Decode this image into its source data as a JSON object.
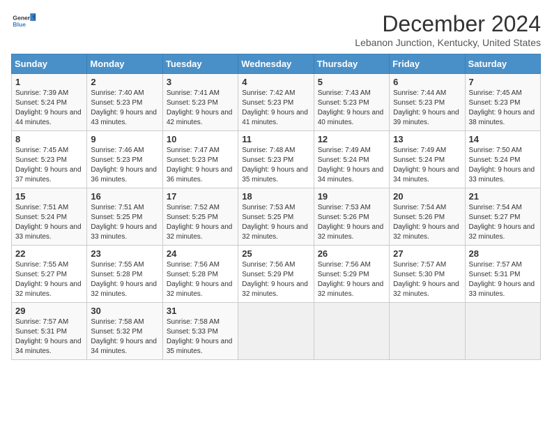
{
  "logo": {
    "general": "General",
    "blue": "Blue"
  },
  "title": "December 2024",
  "location": "Lebanon Junction, Kentucky, United States",
  "days_of_week": [
    "Sunday",
    "Monday",
    "Tuesday",
    "Wednesday",
    "Thursday",
    "Friday",
    "Saturday"
  ],
  "weeks": [
    [
      {
        "day": 1,
        "sunrise": "7:39 AM",
        "sunset": "5:24 PM",
        "daylight": "9 hours and 44 minutes."
      },
      {
        "day": 2,
        "sunrise": "7:40 AM",
        "sunset": "5:23 PM",
        "daylight": "9 hours and 43 minutes."
      },
      {
        "day": 3,
        "sunrise": "7:41 AM",
        "sunset": "5:23 PM",
        "daylight": "9 hours and 42 minutes."
      },
      {
        "day": 4,
        "sunrise": "7:42 AM",
        "sunset": "5:23 PM",
        "daylight": "9 hours and 41 minutes."
      },
      {
        "day": 5,
        "sunrise": "7:43 AM",
        "sunset": "5:23 PM",
        "daylight": "9 hours and 40 minutes."
      },
      {
        "day": 6,
        "sunrise": "7:44 AM",
        "sunset": "5:23 PM",
        "daylight": "9 hours and 39 minutes."
      },
      {
        "day": 7,
        "sunrise": "7:45 AM",
        "sunset": "5:23 PM",
        "daylight": "9 hours and 38 minutes."
      }
    ],
    [
      {
        "day": 8,
        "sunrise": "7:45 AM",
        "sunset": "5:23 PM",
        "daylight": "9 hours and 37 minutes."
      },
      {
        "day": 9,
        "sunrise": "7:46 AM",
        "sunset": "5:23 PM",
        "daylight": "9 hours and 36 minutes."
      },
      {
        "day": 10,
        "sunrise": "7:47 AM",
        "sunset": "5:23 PM",
        "daylight": "9 hours and 36 minutes."
      },
      {
        "day": 11,
        "sunrise": "7:48 AM",
        "sunset": "5:23 PM",
        "daylight": "9 hours and 35 minutes."
      },
      {
        "day": 12,
        "sunrise": "7:49 AM",
        "sunset": "5:24 PM",
        "daylight": "9 hours and 34 minutes."
      },
      {
        "day": 13,
        "sunrise": "7:49 AM",
        "sunset": "5:24 PM",
        "daylight": "9 hours and 34 minutes."
      },
      {
        "day": 14,
        "sunrise": "7:50 AM",
        "sunset": "5:24 PM",
        "daylight": "9 hours and 33 minutes."
      }
    ],
    [
      {
        "day": 15,
        "sunrise": "7:51 AM",
        "sunset": "5:24 PM",
        "daylight": "9 hours and 33 minutes."
      },
      {
        "day": 16,
        "sunrise": "7:51 AM",
        "sunset": "5:25 PM",
        "daylight": "9 hours and 33 minutes."
      },
      {
        "day": 17,
        "sunrise": "7:52 AM",
        "sunset": "5:25 PM",
        "daylight": "9 hours and 32 minutes."
      },
      {
        "day": 18,
        "sunrise": "7:53 AM",
        "sunset": "5:25 PM",
        "daylight": "9 hours and 32 minutes."
      },
      {
        "day": 19,
        "sunrise": "7:53 AM",
        "sunset": "5:26 PM",
        "daylight": "9 hours and 32 minutes."
      },
      {
        "day": 20,
        "sunrise": "7:54 AM",
        "sunset": "5:26 PM",
        "daylight": "9 hours and 32 minutes."
      },
      {
        "day": 21,
        "sunrise": "7:54 AM",
        "sunset": "5:27 PM",
        "daylight": "9 hours and 32 minutes."
      }
    ],
    [
      {
        "day": 22,
        "sunrise": "7:55 AM",
        "sunset": "5:27 PM",
        "daylight": "9 hours and 32 minutes."
      },
      {
        "day": 23,
        "sunrise": "7:55 AM",
        "sunset": "5:28 PM",
        "daylight": "9 hours and 32 minutes."
      },
      {
        "day": 24,
        "sunrise": "7:56 AM",
        "sunset": "5:28 PM",
        "daylight": "9 hours and 32 minutes."
      },
      {
        "day": 25,
        "sunrise": "7:56 AM",
        "sunset": "5:29 PM",
        "daylight": "9 hours and 32 minutes."
      },
      {
        "day": 26,
        "sunrise": "7:56 AM",
        "sunset": "5:29 PM",
        "daylight": "9 hours and 32 minutes."
      },
      {
        "day": 27,
        "sunrise": "7:57 AM",
        "sunset": "5:30 PM",
        "daylight": "9 hours and 32 minutes."
      },
      {
        "day": 28,
        "sunrise": "7:57 AM",
        "sunset": "5:31 PM",
        "daylight": "9 hours and 33 minutes."
      }
    ],
    [
      {
        "day": 29,
        "sunrise": "7:57 AM",
        "sunset": "5:31 PM",
        "daylight": "9 hours and 34 minutes."
      },
      {
        "day": 30,
        "sunrise": "7:58 AM",
        "sunset": "5:32 PM",
        "daylight": "9 hours and 34 minutes."
      },
      {
        "day": 31,
        "sunrise": "7:58 AM",
        "sunset": "5:33 PM",
        "daylight": "9 hours and 35 minutes."
      },
      null,
      null,
      null,
      null
    ]
  ]
}
